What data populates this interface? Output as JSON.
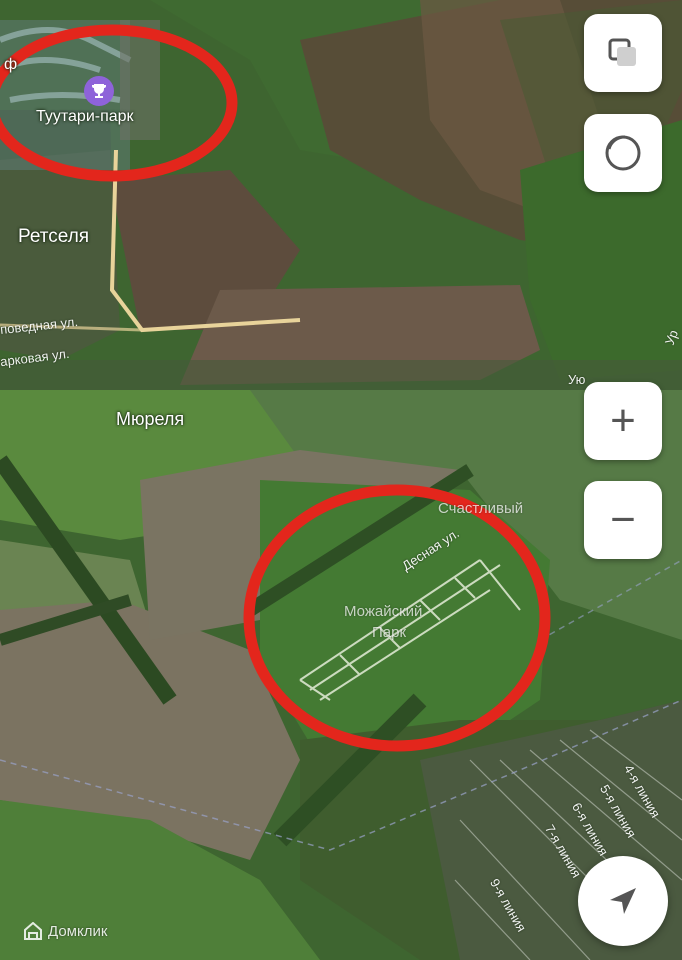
{
  "map": {
    "places": {
      "poi_name": "Туутари-парк",
      "poi_partial": "ф",
      "retselya": "Ретселя",
      "myurelya": "Мюреля",
      "schastlivy": "Счастливый",
      "mozhaysky_line1": "Можайский",
      "mozhaysky_line2": "Парк",
      "yu_partial": "Ую",
      "ur_partial": "Ур"
    },
    "streets": {
      "zapovednaya": "поведная ул.",
      "parkovaya": "арковая ул.",
      "desnaya": "Десная ул.",
      "line4": "4-я линия",
      "line5": "5-я линия",
      "line6": "6-я линия",
      "line7": "7-я линия",
      "line9": "9-я линия"
    },
    "annotation_color": "#e3261c",
    "road_color": "#e8d39a"
  },
  "controls": {
    "layers_icon": "layers-icon",
    "map_mode_icon": "map-mode-icon",
    "zoom_in_label": "+",
    "zoom_out_label": "−",
    "locate_icon": "navigation-arrow-icon"
  },
  "brand": {
    "name": "Домклик",
    "icon": "domclick-logo-icon"
  }
}
